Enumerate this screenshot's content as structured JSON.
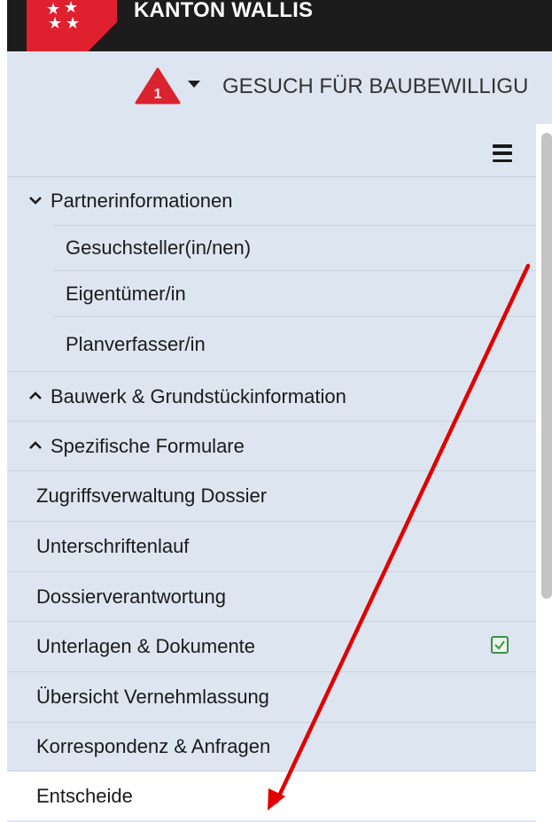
{
  "header": {
    "title": "KANTON WALLIS",
    "badge_number": "1",
    "subtitle": "GESUCH FÜR BAUBEWILLIGU"
  },
  "sidebar": {
    "items": [
      {
        "label": "Partnerinformationen",
        "chevron": "chevron-down-icon",
        "expanded": true
      },
      {
        "label": "Gesuchsteller(in/nen)",
        "level": 2
      },
      {
        "label": "Eigentümer/in",
        "level": 2
      },
      {
        "label": "Planverfasser/in",
        "level": 2
      },
      {
        "label": "Bauwerk & Grundstückinformation",
        "chevron": "chevron-up-icon",
        "expanded": false
      },
      {
        "label": "Spezifische Formulare",
        "chevron": "chevron-up-icon",
        "expanded": false
      },
      {
        "label": "Zugriffsverwaltung Dossier"
      },
      {
        "label": "Unterschriftenlauf"
      },
      {
        "label": "Dossierverantwortung"
      },
      {
        "label": "Unterlagen & Dokumente",
        "status": "checked"
      },
      {
        "label": "Übersicht Vernehmlassung"
      },
      {
        "label": "Korrespondenz & Anfragen"
      },
      {
        "label": "Entscheide",
        "active": true
      }
    ]
  },
  "colors": {
    "brand_red": "#e0202e",
    "topbar": "#1c1c1c",
    "sidebar_bg": "#dde6f0",
    "check_green": "#3f8f4a",
    "annotation_arrow": "#e00000"
  },
  "icons": [
    "hamburger-menu-icon",
    "checkbox-checked-icon",
    "wallis-flag-logo"
  ]
}
